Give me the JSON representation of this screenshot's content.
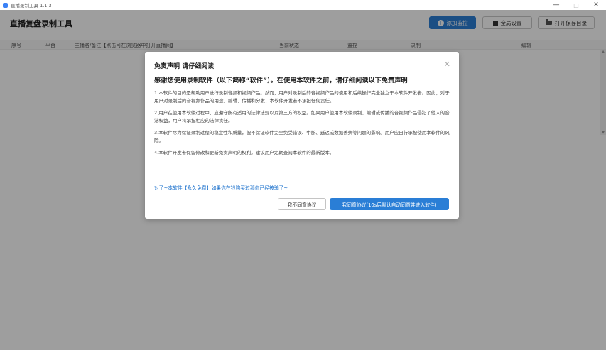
{
  "window": {
    "title": "直播录制工具 1.1.3",
    "controls": {
      "minimize": "—",
      "maximize": "□",
      "close": "✕"
    }
  },
  "header": {
    "app_title": "直播复盘录制工具",
    "add_monitor_label": "添加监控",
    "global_settings_label": "全局设置",
    "open_folder_label": "打开保存目录"
  },
  "table": {
    "columns": [
      "序号",
      "平台",
      "主播名/备注【点击可在浏览器中打开直播间】",
      "当前状态",
      "监控",
      "录制",
      "编辑"
    ]
  },
  "dialog": {
    "title": "免责声明 请仔细阅读",
    "close_label": "✕",
    "subtitle": "感谢您使用录制软件（以下简称“软件”）。在使用本软件之前，请仔细阅读以下免责声明",
    "paragraphs": [
      "1.本软件的目的是帮助用户进行录制音频和视频作品。然而，用户对录制后的音视频作品的使用和后续操作完全独立于本软件开发者。因此，对于用户对录制后的音视频作品的用途、编辑、传播和分发，本软件开发者不承担任何责任。",
      "2.用户在使用本软件过程中，应遵守所有适用的法律法规以及第三方的权益。如果用户使用本软件录制、编辑或传播的音视频作品侵犯了他人的合法权益，用户将承担相应的法律责任。",
      "3.本软件尽力保证录制过程的稳定性和质量，但不保证软件完全免受错误、中断、延迟或数据丢失等问题的影响。用户应自行承担使用本软件的风险。",
      "4.本软件开发者保留修改和更新免责声明的权利。建议用户定期查阅本软件的最新版本。"
    ],
    "note": "对了~本软件【永久免费】如果你在钱购买过那你已经被骗了~",
    "disagree_label": "我不同意协议",
    "agree_label": "我同意协议(10s后默认自动同意并进入软件)"
  },
  "colors": {
    "primary": "#2a7ed6",
    "link": "#1a70cc",
    "overlay": "rgba(0,0,0,0.38)"
  }
}
